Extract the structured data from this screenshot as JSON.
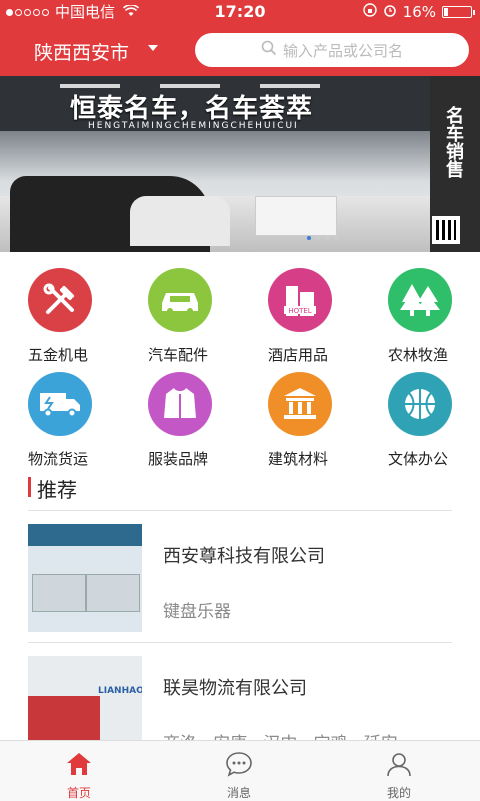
{
  "status_bar": {
    "carrier": "中国电信",
    "time": "17:20",
    "battery": "16%",
    "battery_level": 0.16
  },
  "header": {
    "city": "陕西西安市",
    "search_placeholder": "输入产品或公司名"
  },
  "banner": {
    "title": "恒泰名车，名车荟萃",
    "subtitle": "HENGTAIMINGCHEMINGCHEHUICUI",
    "sign_text": "名车销售",
    "page_count": 4,
    "active_page": 0
  },
  "categories": [
    {
      "label": "五金机电",
      "icon": "tools-icon",
      "color": "#d94146"
    },
    {
      "label": "汽车配件",
      "icon": "car-icon",
      "color": "#8cc63e"
    },
    {
      "label": "酒店用品",
      "icon": "hotel-icon",
      "color": "#d63e88"
    },
    {
      "label": "农林牧渔",
      "icon": "trees-icon",
      "color": "#2fbe6a"
    },
    {
      "label": "物流货运",
      "icon": "truck-icon",
      "color": "#3ba3d8"
    },
    {
      "label": "服装品牌",
      "icon": "jacket-icon",
      "color": "#c457c6"
    },
    {
      "label": "建筑材料",
      "icon": "building-icon",
      "color": "#f08f28"
    },
    {
      "label": "文体办公",
      "icon": "ball-icon",
      "color": "#2fa3b5"
    }
  ],
  "recommend": {
    "title": "推荐",
    "items": [
      {
        "name": "西安尊科技有限公司",
        "desc": "键盘乐器"
      },
      {
        "name": "联昊物流有限公司",
        "desc": "商洛   安康   汉中   宝鸡   延安"
      }
    ]
  },
  "tabbar": {
    "tabs": [
      {
        "label": "首页",
        "icon": "home-icon",
        "active": true
      },
      {
        "label": "消息",
        "icon": "message-icon",
        "active": false
      },
      {
        "label": "我的",
        "icon": "profile-icon",
        "active": false
      }
    ]
  },
  "colors": {
    "brand": "#e03a3c",
    "active_tab": "#e03a3c"
  }
}
